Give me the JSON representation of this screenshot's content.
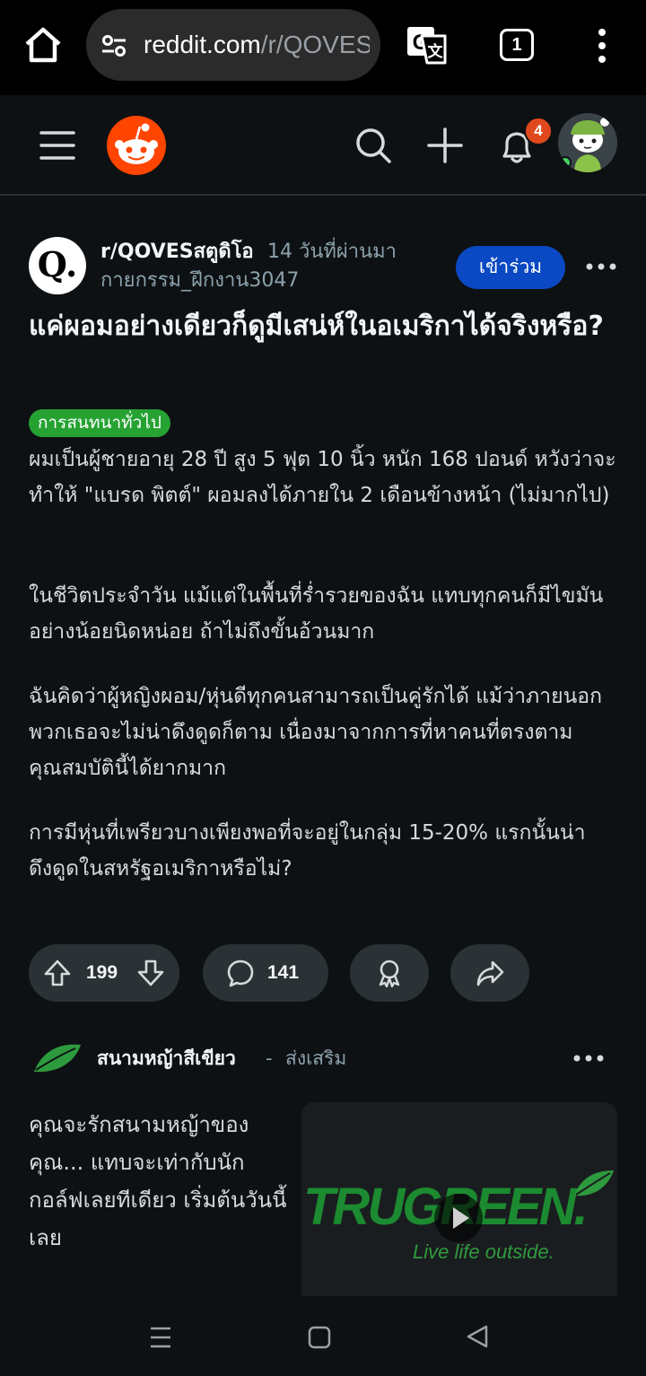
{
  "browser": {
    "url_domain": "reddit.com",
    "url_path": "/r/QOVESstudio",
    "tab_count": "1"
  },
  "header": {
    "notification_count": "4"
  },
  "post": {
    "subreddit": "r/QOVESสตูดิโอ",
    "age": "14 วันที่ผ่านมา",
    "author": "กายกรรม_ฝึกงาน3047",
    "join_label": "เข้าร่วม",
    "title": "แค่ผอมอย่างเดียวก็ดูมีเสน่ห์ในอเมริกาได้จริงหรือ?",
    "flair": "การสนทนาทั่วไป",
    "flair_color": "#26a232",
    "paragraphs": [
      "ผมเป็นผู้ชายอายุ 28 ปี สูง 5 ฟุต 10 นิ้ว หนัก 168 ปอนด์ หวังว่าจะทำให้ \"แบรด พิตต์\" ผอมลงได้ภายใน 2 เดือนข้างหน้า (ไม่มากไป)",
      "ในชีวิตประจำวัน แม้แต่ในพื้นที่ร่ำรวยของฉัน แทบทุกคนก็มีไขมันอย่างน้อยนิดหน่อย ถ้าไม่ถึงขั้นอ้วนมาก",
      "ฉันคิดว่าผู้หญิงผอม/หุ่นดีทุกคนสามารถเป็นคู่รักได้ แม้ว่าภายนอกพวกเธอจะไม่น่าดึงดูดก็ตาม เนื่องมาจากการที่หาคนที่ตรงตามคุณสมบัตินี้ได้ยากมาก",
      "การมีหุ่นที่เพรียวบางเพียงพอที่จะอยู่ในกลุ่ม 15-20% แรกนั้นน่าดึงดูดในสหรัฐอเมริกาหรือไม่?"
    ],
    "upvotes": "199",
    "comments": "141"
  },
  "ad": {
    "advertiser": "สนามหญ้าสีเขียว",
    "separator": "-",
    "promoted_label": "ส่งเสริม",
    "text": "คุณจะรักสนามหญ้าของคุณ... แทบจะเท่ากับนักกอล์ฟเลยทีเดียว เริ่มต้นวันนี้เลย",
    "brand": "TRUGREEN.",
    "tagline": "Live life outside.",
    "brand_color": "#1c8a30"
  },
  "colors": {
    "background": "#0e1113",
    "join_button": "#0a49c3",
    "badge": "#e0491d",
    "reddit_orange": "#ff4500"
  }
}
